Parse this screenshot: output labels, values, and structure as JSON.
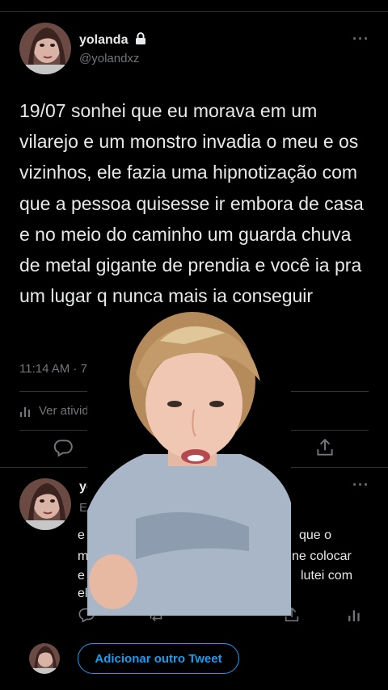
{
  "tweet": {
    "name": "yolanda",
    "handle": "@yolandxz",
    "more": "···",
    "text": "19/07 sonhei que eu morava em um vilarejo e um monstro invadia o meu e os vizinhos, ele fazia uma hipnotização com que a pessoa quisesse ir embora de casa e no meio do caminho um guarda chuva de metal gigante de prendia e você ia pra um lugar q nunca mais ia conseguir",
    "timestamp": "11:14 AM · 7/21/21 · T",
    "activity_label": "Ver atividade do",
    "icons": {
      "lock": "lock-icon",
      "reply": "reply-icon",
      "retweet": "retweet-icon",
      "share": "share-icon",
      "activity": "analytics-icon"
    }
  },
  "reply": {
    "name": "yolanda",
    "sub": "Em r",
    "line1_left": "e",
    "line1_right": "que o",
    "line2_left": "m",
    "line2_right": "ne colocar",
    "line3_left": "e",
    "line3_right": "lutei com",
    "line4_left": "el",
    "line4_right": "tes",
    "more": "···"
  },
  "compose": {
    "add_button_label": "Adicionar outro Tweet"
  },
  "colors": {
    "background": "#000000",
    "text": "#e7e9ea",
    "muted": "#71767b",
    "divider": "#2f3336",
    "accent": "#1d9bf0"
  }
}
